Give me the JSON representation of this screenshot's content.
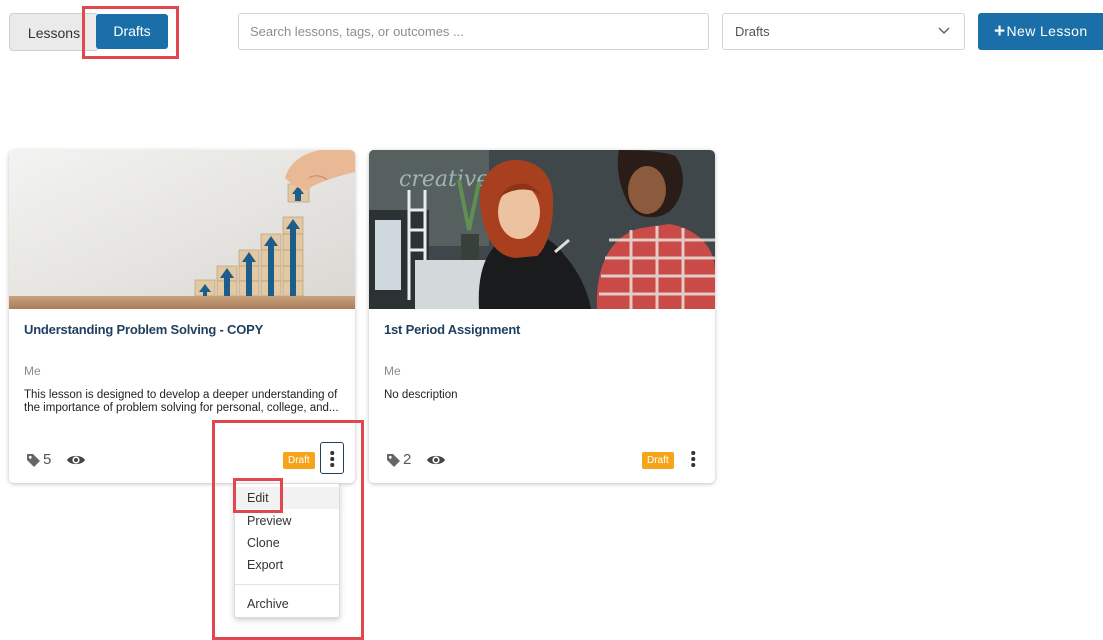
{
  "toolbar": {
    "tabs": [
      {
        "label": "Lessons"
      },
      {
        "label": "Drafts"
      }
    ],
    "search_placeholder": "Search lessons, tags, or outcomes ...",
    "filter_selected": "Drafts",
    "new_lesson_label": "New Lesson",
    "new_lesson_plus": "+"
  },
  "cards": [
    {
      "title": "Understanding Problem Solving - COPY",
      "author": "Me",
      "description": "This lesson is designed to develop a deeper understanding of the importance of problem solving for personal, college, and...",
      "tag_count": "5",
      "badge": "Draft",
      "thumbnail": "growth-stairs-blocks-image"
    },
    {
      "title": "1st Period Assignment",
      "author": "Me",
      "description": "No description",
      "tag_count": "2",
      "badge": "Draft",
      "thumbnail": "students-at-laptop-image"
    }
  ],
  "menu": {
    "items": [
      {
        "label": "Edit"
      },
      {
        "label": "Preview"
      },
      {
        "label": "Clone"
      },
      {
        "label": "Export"
      },
      {
        "label": "Archive"
      }
    ]
  },
  "colors": {
    "primary": "#1b6fa8",
    "badge": "#f6a51b",
    "highlight": "#e0484e",
    "title": "#1f3f5f"
  },
  "icons": [
    "chevron-down-icon",
    "tag-icon",
    "eye-icon",
    "more-vertical-icon",
    "plus-icon"
  ]
}
